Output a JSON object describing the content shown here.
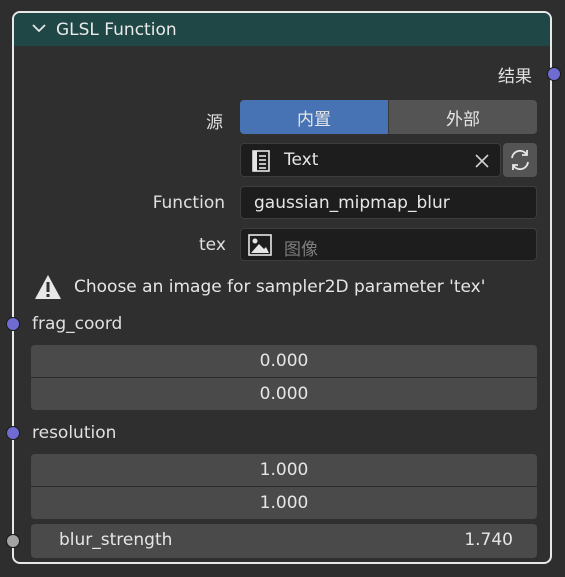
{
  "node": {
    "title": "GLSL Function",
    "output_label": "结果",
    "source": {
      "label": "源",
      "options": [
        "内置",
        "外部"
      ],
      "selected": "内置"
    },
    "text_block": {
      "name": "Text"
    },
    "function": {
      "label": "Function",
      "value": "gaussian_mipmap_blur"
    },
    "tex": {
      "label": "tex",
      "placeholder": "图像"
    },
    "warning": "Choose an image for sampler2D parameter 'tex'",
    "frag_coord": {
      "label": "frag_coord",
      "values": [
        "0.000",
        "0.000"
      ]
    },
    "resolution": {
      "label": "resolution",
      "values": [
        "1.000",
        "1.000"
      ]
    },
    "blur_strength": {
      "label": "blur_strength",
      "value": "1.740"
    }
  },
  "colors": {
    "header": "#1f4745",
    "accent": "#4772b3",
    "vector_socket": "#6f6bd1",
    "float_socket": "#a3a3a3"
  },
  "icons": [
    "chevron-down-icon",
    "text-datablock-icon",
    "clear-x-icon",
    "reload-icon",
    "image-icon",
    "warning-icon"
  ]
}
